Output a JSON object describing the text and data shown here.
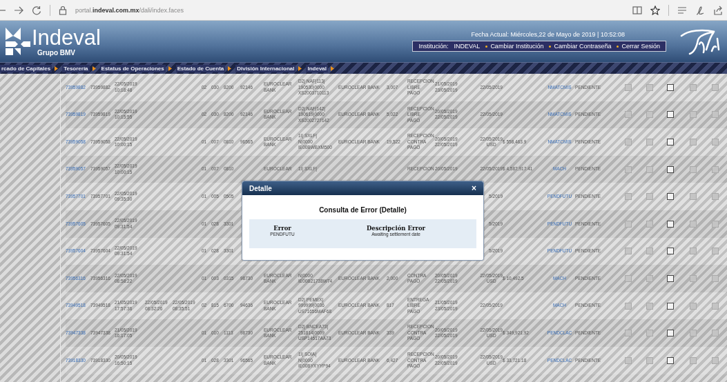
{
  "browser": {
    "url": "portal.**indeval.com.mx**/dali/index.faces"
  },
  "header": {
    "logo_text": "Indeval",
    "logo_subtitle": "Grupo BMV",
    "date": "Fecha Actual: Miércoles,22 de Mayo de 2019 | 10:52:08",
    "institution_label": "Institución:",
    "institution": "INDEVAL",
    "links": [
      "Cambiar Institución",
      "Cambiar Contraseña",
      "Cerrar Sesión"
    ]
  },
  "menu": [
    "rcado de Capitales",
    "Tesorería",
    "Estatus de Operaciones",
    "Estado de Cuenta",
    "División Internacional",
    "Indeval"
  ],
  "table": {
    "rows": [
      {
        "column_1": "73959882",
        "column_2": "73959882",
        "column_3": [
          "22/05/2019",
          "10:18:48"
        ],
        "column_6": "02",
        "column_7": "030",
        "column_8": "8200",
        "column_9": "92146",
        "column_10": [
          "EUROCLEAR",
          "BANK"
        ],
        "column_11": [
          "D2| NAF|113|",
          "190530|0000",
          "XS2003710113"
        ],
        "column_12": "EUROCLEAR BANK",
        "column_13": "3,007",
        "column_14": [
          "RECEPCION",
          "LIBRE",
          "PAGO"
        ],
        "column_15": [
          "21/05/2019",
          "23/05/2019"
        ],
        "column_16": [
          "22/05/2019"
        ],
        "column_18": "NMATCMIS",
        "column_19": "PENDIENTE",
        "checkboxes": [
          {
            "disabled": true
          },
          {
            "disabled": true
          },
          {
            "disabled": false
          },
          {
            "disabled": true
          },
          {
            "disabled": true
          }
        ]
      },
      {
        "column_1": "73959819",
        "column_2": "73959819",
        "column_3": [
          "22/05/2019",
          "10:15:55"
        ],
        "column_6": "02",
        "column_7": "030",
        "column_8": "8200",
        "column_9": "92146",
        "column_10": [
          "EUROCLEAR",
          "BANK"
        ],
        "column_11": [
          "D2| NAF|142|",
          "190619|0000",
          "XS2002727142"
        ],
        "column_12": "EUROCLEAR BANK",
        "column_13": "5,022",
        "column_14": [
          "RECEPCION",
          "LIBRE",
          "PAGO"
        ],
        "column_15": [
          "20/05/2019",
          "22/05/2019"
        ],
        "column_16": [
          "22/05/2019"
        ],
        "column_18": "NMATCMIS",
        "column_19": "PENDIENTE",
        "checkboxes": [
          {
            "disabled": true
          },
          {
            "disabled": true
          },
          {
            "disabled": false
          },
          {
            "disabled": true
          },
          {
            "disabled": true
          }
        ]
      },
      {
        "column_1": "73959058",
        "column_2": "73959058",
        "column_3": [
          "22/05/2019",
          "10:00:15"
        ],
        "column_6": "01",
        "column_7": "007",
        "column_8": "0810",
        "column_9": "96565",
        "column_10": [
          "EUROCLEAR",
          "BANK"
        ],
        "column_11": [
          "1I| SXLF|",
          "N|0000",
          "IE00BWBXM500"
        ],
        "column_12": "EUROCLEAR BANK",
        "column_13": "19,522",
        "column_14": [
          "RECEPCION",
          "CONTRA",
          "PAGO"
        ],
        "column_15": [
          "20/05/2019",
          "22/05/2019"
        ],
        "column_16": [
          "22/05/2019",
          "USD"
        ],
        "column_17": "$ 558,463.9",
        "column_18": "NMATCMIS",
        "column_19": "PENDIENTE",
        "checkboxes": [
          {
            "disabled": true
          },
          {
            "disabled": true
          },
          {
            "disabled": false
          },
          {
            "disabled": true
          },
          {
            "disabled": true
          }
        ]
      },
      {
        "column_1": "73959057",
        "column_2": "73959057",
        "column_3": [
          "22/05/2019",
          "10:00:15"
        ],
        "column_6": "01",
        "column_7": "007",
        "column_8": "0810",
        "column_10": [
          "EUROCLEAR"
        ],
        "column_11": [
          "1I| SXLF|"
        ],
        "column_14": [
          "RECEPCION"
        ],
        "column_15": [
          "20/05/2019"
        ],
        "column_16": [
          "22/05/2019"
        ],
        "column_17": "$ 4,587,917.41",
        "column_18": "MACH",
        "column_19": "PENDIENTE",
        "checkboxes": [
          {
            "disabled": true
          },
          {
            "disabled": true
          },
          {
            "disabled": false
          },
          {
            "disabled": true
          },
          {
            "disabled": true
          }
        ]
      },
      {
        "column_1": "73957701",
        "column_2": "73957701",
        "column_3": [
          "22/05/2019",
          "09:35:30"
        ],
        "column_6": "01",
        "column_7": "005",
        "column_8": "0505",
        "column_16": [
          "5/2019"
        ],
        "column_18": "PENDFUTU",
        "column_19": "PENDIENTE",
        "checkboxes": [
          {
            "disabled": true
          },
          {
            "disabled": true
          },
          {
            "disabled": false
          },
          {
            "disabled": true
          },
          {
            "disabled": true
          }
        ]
      },
      {
        "column_1": "73957605",
        "column_2": "73957605",
        "column_3": [
          "22/05/2019",
          "09:31:54"
        ],
        "column_6": "01",
        "column_7": "028",
        "column_8": "3301",
        "column_16": [
          "5/2019"
        ],
        "column_18": "PENDFUTU",
        "column_19": "PENDIENTE",
        "checkboxes": [
          {
            "disabled": true
          },
          {
            "disabled": true
          },
          {
            "disabled": false
          },
          {
            "disabled": true
          },
          {
            "disabled": true
          }
        ]
      },
      {
        "column_1": "73957604",
        "column_2": "73957604",
        "column_3": [
          "22/05/2019",
          "09:31:54"
        ],
        "column_6": "01",
        "column_7": "028",
        "column_8": "3301",
        "column_16": [
          "5/2019"
        ],
        "column_18": "PENDFUTU",
        "column_19": "PENDIENTE",
        "checkboxes": [
          {
            "disabled": true
          },
          {
            "disabled": true
          },
          {
            "disabled": false
          },
          {
            "disabled": true
          },
          {
            "disabled": true
          }
        ]
      },
      {
        "column_1": "73956316",
        "column_2": "73956316",
        "column_3": [
          "22/05/2019",
          "08:58:22"
        ],
        "column_6": "01",
        "column_7": "003",
        "column_8": "0315",
        "column_9": "98730",
        "column_10": [
          "EUROCLEAR",
          "BANK"
        ],
        "column_11": [
          "N|0000",
          "IE00B21738W74"
        ],
        "column_12": "EUROCLEAR BANK",
        "column_13": "2,000",
        "column_14": [
          "CONTRA",
          "PAGO"
        ],
        "column_15": [
          "20/05/2019",
          "22/05/2019"
        ],
        "column_16": [
          "22/05/2019",
          "USD"
        ],
        "column_17": "$ 10,492.5",
        "column_18": "MACH",
        "column_19": "PENDIENTE",
        "checkboxes": [
          {
            "disabled": true
          },
          {
            "disabled": true
          },
          {
            "disabled": false
          },
          {
            "disabled": true
          },
          {
            "disabled": true
          }
        ]
      },
      {
        "column_1": "73949518",
        "column_2": "73949518",
        "column_3": [
          "21/05/2019",
          "17:57:36"
        ],
        "column_4": [
          "22/05/2019",
          "08:32:26"
        ],
        "column_5": [
          "22/05/2019",
          "08:35:51"
        ],
        "column_6": "02",
        "column_7": "815",
        "column_8": "6700",
        "column_9": "94636",
        "column_10": [
          "EUROCLEAR",
          "BANK"
        ],
        "column_11": [
          "D2| PEMEX|",
          "999999|0036",
          "US71656MAF68"
        ],
        "column_12": "EUROCLEAR BANK",
        "column_13": "817",
        "column_14": [
          "ENTREGA",
          "LIBRE",
          "PAGO"
        ],
        "column_15": [
          "21/05/2019",
          "23/05/2019"
        ],
        "column_16": [
          "22/05/2019"
        ],
        "column_18": "MACH",
        "column_19": "PENDIENTE",
        "checkboxes": [
          {
            "disabled": true
          },
          {
            "disabled": true
          },
          {
            "disabled": false
          },
          {
            "disabled": true
          },
          {
            "disabled": true
          }
        ]
      },
      {
        "column_1": "73947338",
        "column_2": "73947338",
        "column_3": [
          "21/05/2019",
          "16:17:05"
        ],
        "column_6": "01",
        "column_7": "010",
        "column_8": "1113",
        "column_9": "98730",
        "column_10": [
          "EUROCLEAR",
          "BANK"
        ],
        "column_11": [
          "D2| BNCEA73|",
          "251814|0009",
          "USP14517AA73"
        ],
        "column_12": "EUROCLEAR BANK",
        "column_13": "339",
        "column_14": [
          "RECEPCION",
          "CONTRA",
          "PAGO"
        ],
        "column_15": [
          "20/05/2019",
          "22/05/2019"
        ],
        "column_16": [
          "22/05/2019",
          "USD"
        ],
        "column_17": "$ 349,921.92",
        "column_18": "PENDCLAC",
        "column_19": "PENDIENTE",
        "checkboxes": [
          {
            "disabled": true
          },
          {
            "disabled": true
          },
          {
            "disabled": false
          },
          {
            "disabled": true
          },
          {
            "disabled": true
          }
        ]
      },
      {
        "column_1": "73918330",
        "column_2": "73918330",
        "column_3": [
          "20/05/2019",
          "16:50:15"
        ],
        "column_6": "01",
        "column_7": "028",
        "column_8": "3301",
        "column_9": "96565",
        "column_10": [
          "EUROCLEAR",
          "BANK"
        ],
        "column_11": [
          "1I| SOIA|",
          "N|0000",
          "IE00BYXYYP94"
        ],
        "column_12": "EUROCLEAR BANK",
        "column_13": "6,427",
        "column_14": [
          "RECEPCION",
          "CONTRA",
          "PAGO"
        ],
        "column_15": [
          "20/05/2019",
          "22/05/2019"
        ],
        "column_16": [
          "22/05/2019",
          "USD"
        ],
        "column_17": "$ 33,721.18",
        "column_18": "PENDCLAC",
        "column_19": "PENDIENTE",
        "checkboxes": [
          {
            "disabled": true
          },
          {
            "disabled": true
          },
          {
            "disabled": false
          },
          {
            "disabled": true
          },
          {
            "disabled": true
          }
        ]
      }
    ]
  },
  "dialog": {
    "title": "Detalle",
    "close": "×",
    "heading": "Consulta de Error (Detalle)",
    "columns": [
      {
        "header": "Error",
        "value": "PENDFUTU"
      },
      {
        "header": "Descripción Error",
        "value": "Awaiting settlement date"
      }
    ]
  }
}
